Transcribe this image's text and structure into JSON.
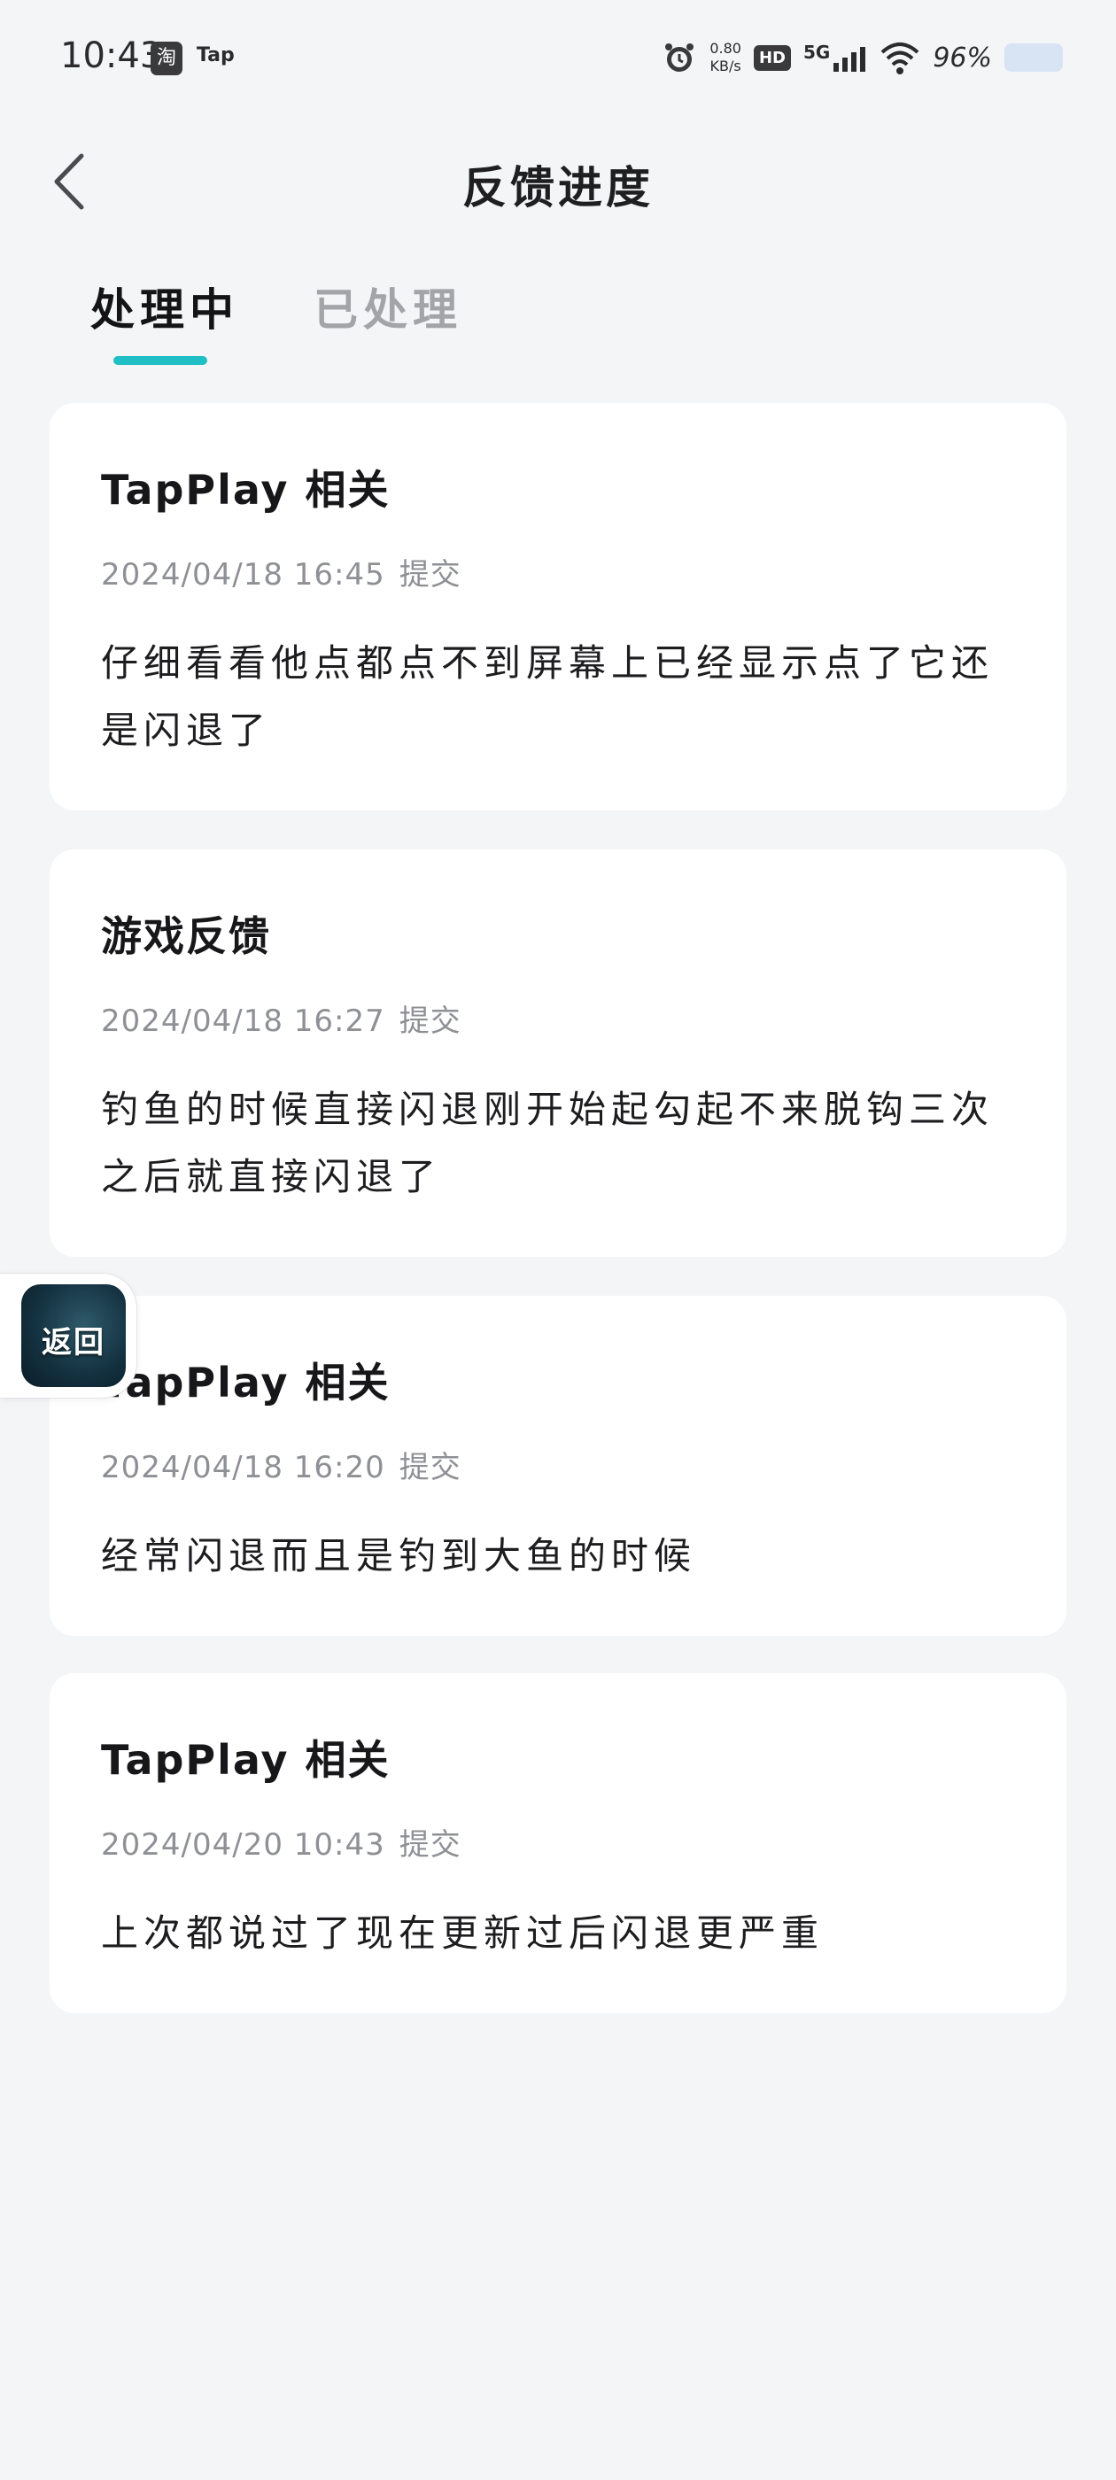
{
  "status_bar": {
    "time": "10:43",
    "app_icon_text": "淘",
    "tap_text": "Tap",
    "net_speed_value": "0.80",
    "net_speed_unit": "KB/s",
    "hd_label": "HD",
    "network_label": "5G",
    "battery_percent": "96%"
  },
  "header": {
    "title": "反馈进度"
  },
  "tabs": [
    {
      "label": "处理中",
      "active": true
    },
    {
      "label": "已处理",
      "active": false
    }
  ],
  "feedback_items": [
    {
      "category": "TapPlay 相关",
      "datetime": "2024/04/18 16:45",
      "submit_label": "提交",
      "content": "仔细看看他点都点不到屏幕上已经显示点了它还是闪退了"
    },
    {
      "category": "游戏反馈",
      "datetime": "2024/04/18 16:27",
      "submit_label": "提交",
      "content": "钓鱼的时候直接闪退刚开始起勾起不来脱钩三次之后就直接闪退了"
    },
    {
      "category": "TapPlay 相关",
      "datetime": "2024/04/18 16:20",
      "submit_label": "提交",
      "content": "经常闪退而且是钓到大鱼的时候"
    },
    {
      "category": "TapPlay 相关",
      "datetime": "2024/04/20 10:43",
      "submit_label": "提交",
      "content": "上次都说过了现在更新过后闪退更严重"
    }
  ],
  "float_button": {
    "label": "返回"
  },
  "colors": {
    "background": "#f4f5f7",
    "card": "#ffffff",
    "accent": "#1fbfc5",
    "meta_text": "#8f9095"
  }
}
